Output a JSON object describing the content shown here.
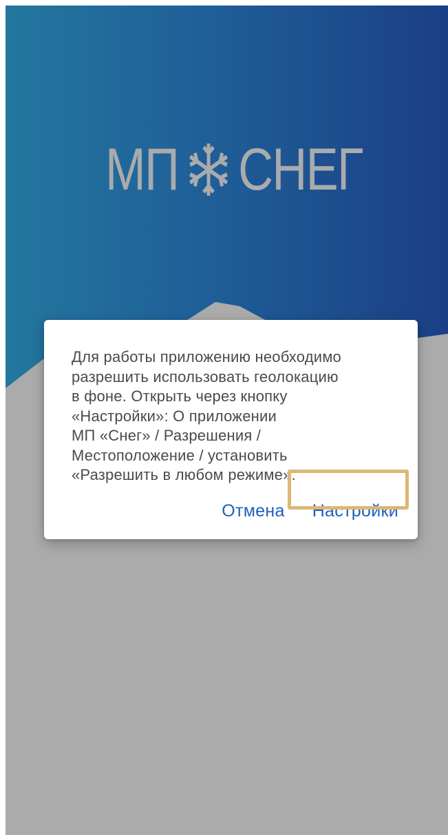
{
  "app": {
    "logo_text_left": "МП",
    "logo_text_right": "СНЕГ",
    "logo_icon": "snowflake-icon"
  },
  "dialog": {
    "message": "Для работы приложению необходимо\nразрешить использовать геолокацию\nв фоне. Открыть через кнопку\n«Настройки»: О приложении\nМП «Снег» / Разрешения /\nМестоположение / установить\n«Разрешить в любом режиме».",
    "cancel_label": "Отмена",
    "settings_label": "Настройки"
  },
  "colors": {
    "background_gradient_start": "#23779e",
    "background_gradient_end": "#1b3f86",
    "mountain": "#ababab",
    "logo": "#a9abad",
    "dialog_button": "#1e5fbf",
    "highlight": "#dcb776"
  }
}
